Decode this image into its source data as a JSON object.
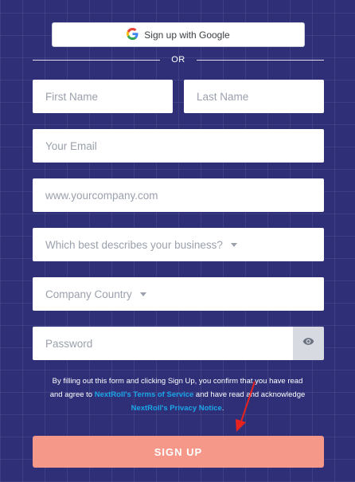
{
  "google_button": {
    "label": "Sign up with Google",
    "icon": "google-icon"
  },
  "divider": {
    "label": "OR"
  },
  "form": {
    "first_name_placeholder": "First Name",
    "last_name_placeholder": "Last Name",
    "email_placeholder": "Your Email",
    "website_placeholder": "www.yourcompany.com",
    "business_select": "Which best describes your business?",
    "country_select": "Company Country",
    "password_placeholder": "Password"
  },
  "legal": {
    "text1": "By filling out this form and clicking Sign Up, you confirm that you have read and agree to ",
    "terms_link": "NextRoll's Terms of Service",
    "text2": " and have read and acknowledge ",
    "privacy_link": "NextRoll's Privacy Notice",
    "text3": "."
  },
  "signup_button": {
    "label": "SIGN UP"
  },
  "colors": {
    "background": "#2f2f78",
    "signup": "#f5988a",
    "link": "#1ba7e8",
    "annotation_arrow": "#e8231f"
  }
}
